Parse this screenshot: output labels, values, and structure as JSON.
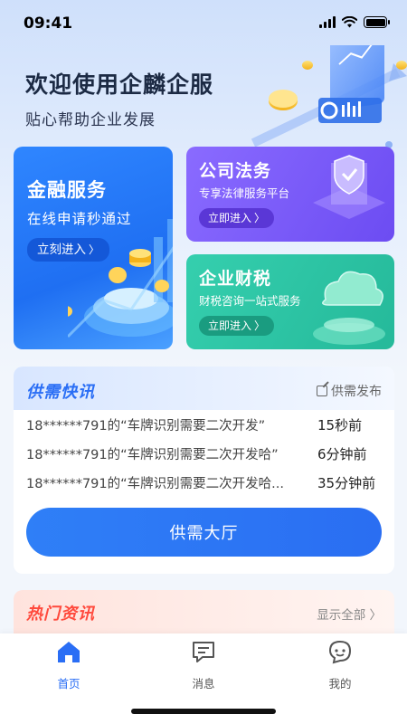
{
  "status_bar": {
    "time": "09:41"
  },
  "hero": {
    "title": "欢迎使用企麟企服",
    "subtitle": "贴心帮助企业发展"
  },
  "cards": {
    "finance": {
      "title": "金融服务",
      "desc": "在线申请秒通过",
      "button": "立刻进入"
    },
    "law": {
      "title": "公司法务",
      "desc": "专享法律服务平台",
      "button": "立即进入"
    },
    "tax": {
      "title": "企业财税",
      "desc": "财税咨询一站式服务",
      "button": "立即进入"
    }
  },
  "supply_demand": {
    "title": "供需快讯",
    "publish": "供需发布",
    "rows": [
      {
        "text": "18******791的“车牌识别需要二次开发”",
        "time": "15秒前"
      },
      {
        "text": "18******791的“车牌识别需要二次开发哈”",
        "time": "6分钟前"
      },
      {
        "text": "18******791的“车牌识别需要二次开发哈...",
        "time": "35分钟前"
      }
    ],
    "hall_button": "供需大厅"
  },
  "hot_news": {
    "title": "热门资讯",
    "show_all": "显示全部 〉"
  },
  "tab_bar": {
    "items": [
      {
        "label": "首页",
        "icon": "home-icon",
        "active": true
      },
      {
        "label": "消息",
        "icon": "message-icon",
        "active": false
      },
      {
        "label": "我的",
        "icon": "profile-icon",
        "active": false
      }
    ]
  },
  "colors": {
    "primary": "#2a6ef5",
    "finance_card": "#2f86ff",
    "law_card": "#7b5cf8",
    "tax_card": "#30c8a6",
    "hot_title": "#ff4a3d"
  }
}
